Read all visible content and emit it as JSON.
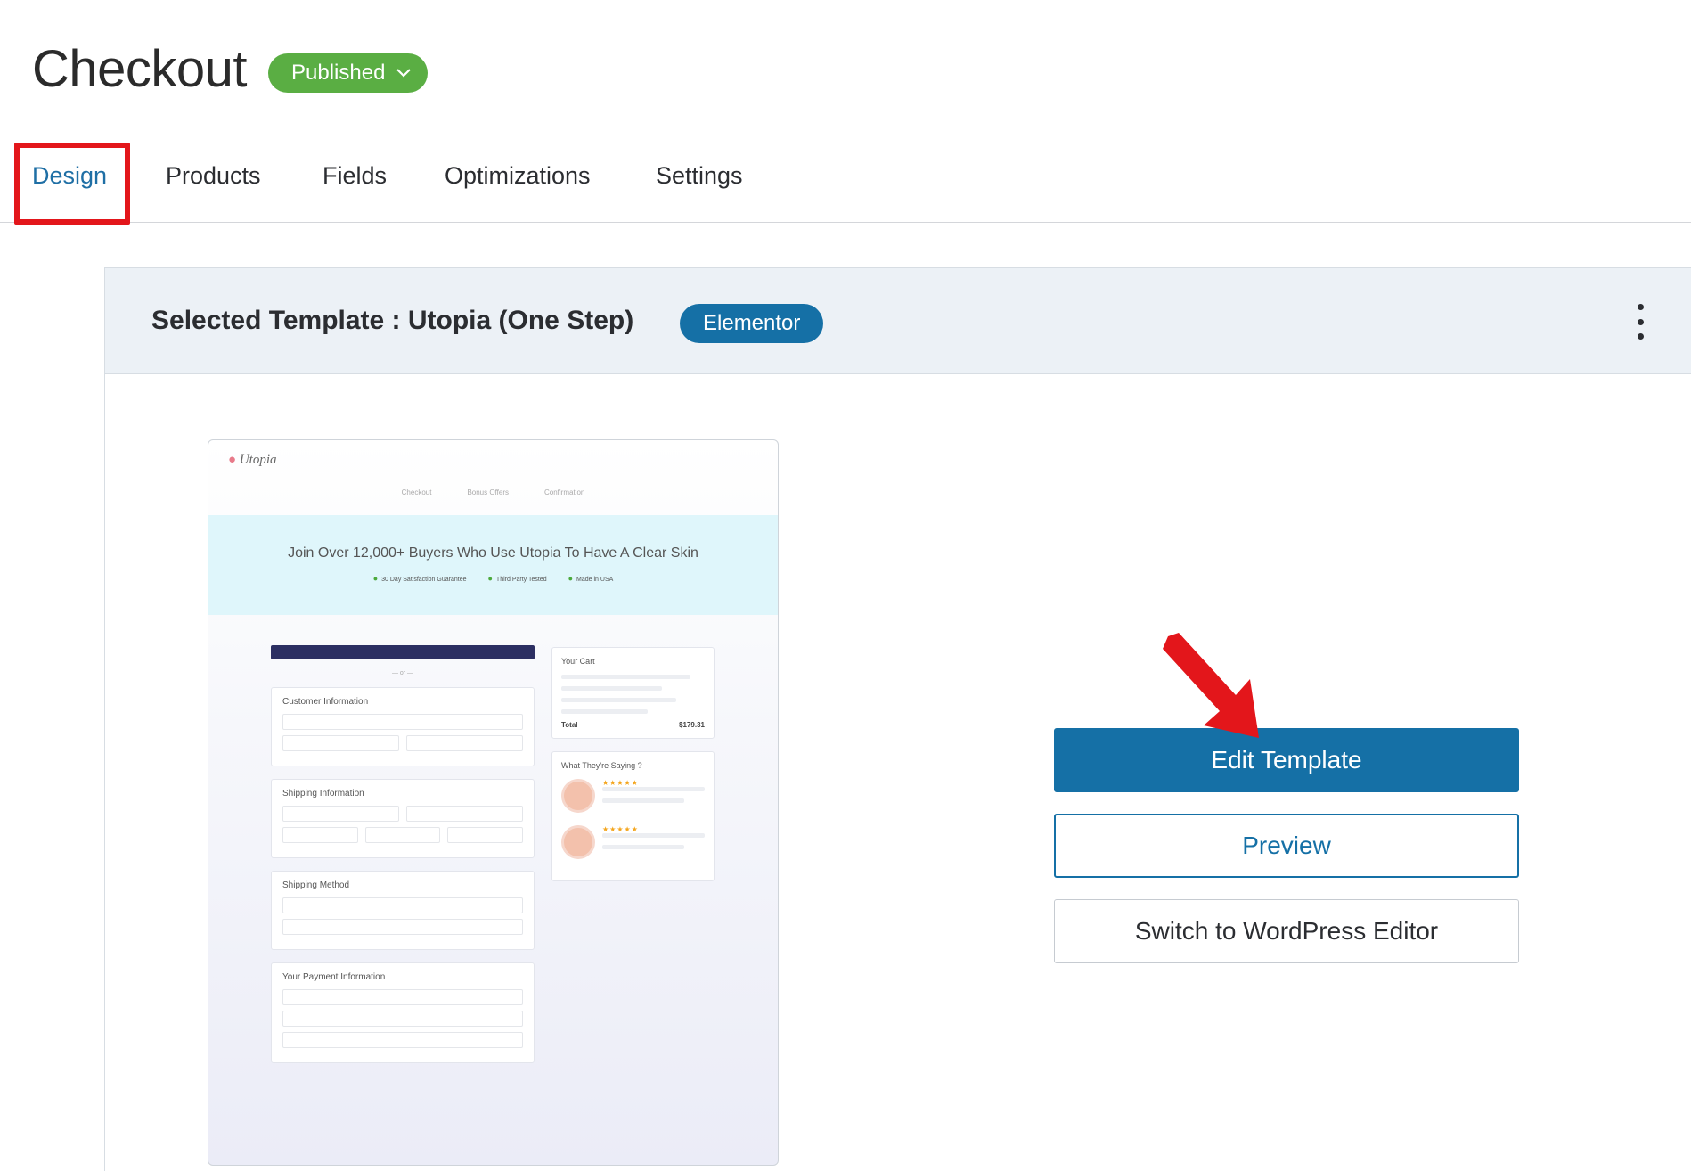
{
  "header": {
    "title": "Checkout",
    "status": "Published"
  },
  "tabs": [
    {
      "label": "Design",
      "active": true
    },
    {
      "label": "Products",
      "active": false
    },
    {
      "label": "Fields",
      "active": false
    },
    {
      "label": "Optimizations",
      "active": false
    },
    {
      "label": "Settings",
      "active": false
    }
  ],
  "template": {
    "label": "Selected Template :  Utopia  (One Step)",
    "builder": "Elementor"
  },
  "actions": {
    "edit": "Edit Template",
    "preview": "Preview",
    "switch": "Switch to WordPress Editor"
  },
  "thumbnail": {
    "brand": "Utopia",
    "steps": [
      "Checkout",
      "Bonus Offers",
      "Confirmation"
    ],
    "headline": "Join Over 12,000+ Buyers Who Use Utopia To Have A Clear Skin",
    "badges": [
      "30 Day Satisfaction Guarantee",
      "Third Party Tested",
      "Made in USA"
    ],
    "sections": [
      "Customer Information",
      "Shipping Information",
      "Shipping Method",
      "Your Payment Information"
    ],
    "cart_title": "Your Cart",
    "cart_total_label": "Total",
    "cart_total_value": "$179.31",
    "reviews_title": "What They're Saying ?",
    "stars": "★★★★★"
  },
  "colors": {
    "accent": "#1570a6",
    "status_green": "#5aae43",
    "highlight_red": "#e3161b"
  }
}
